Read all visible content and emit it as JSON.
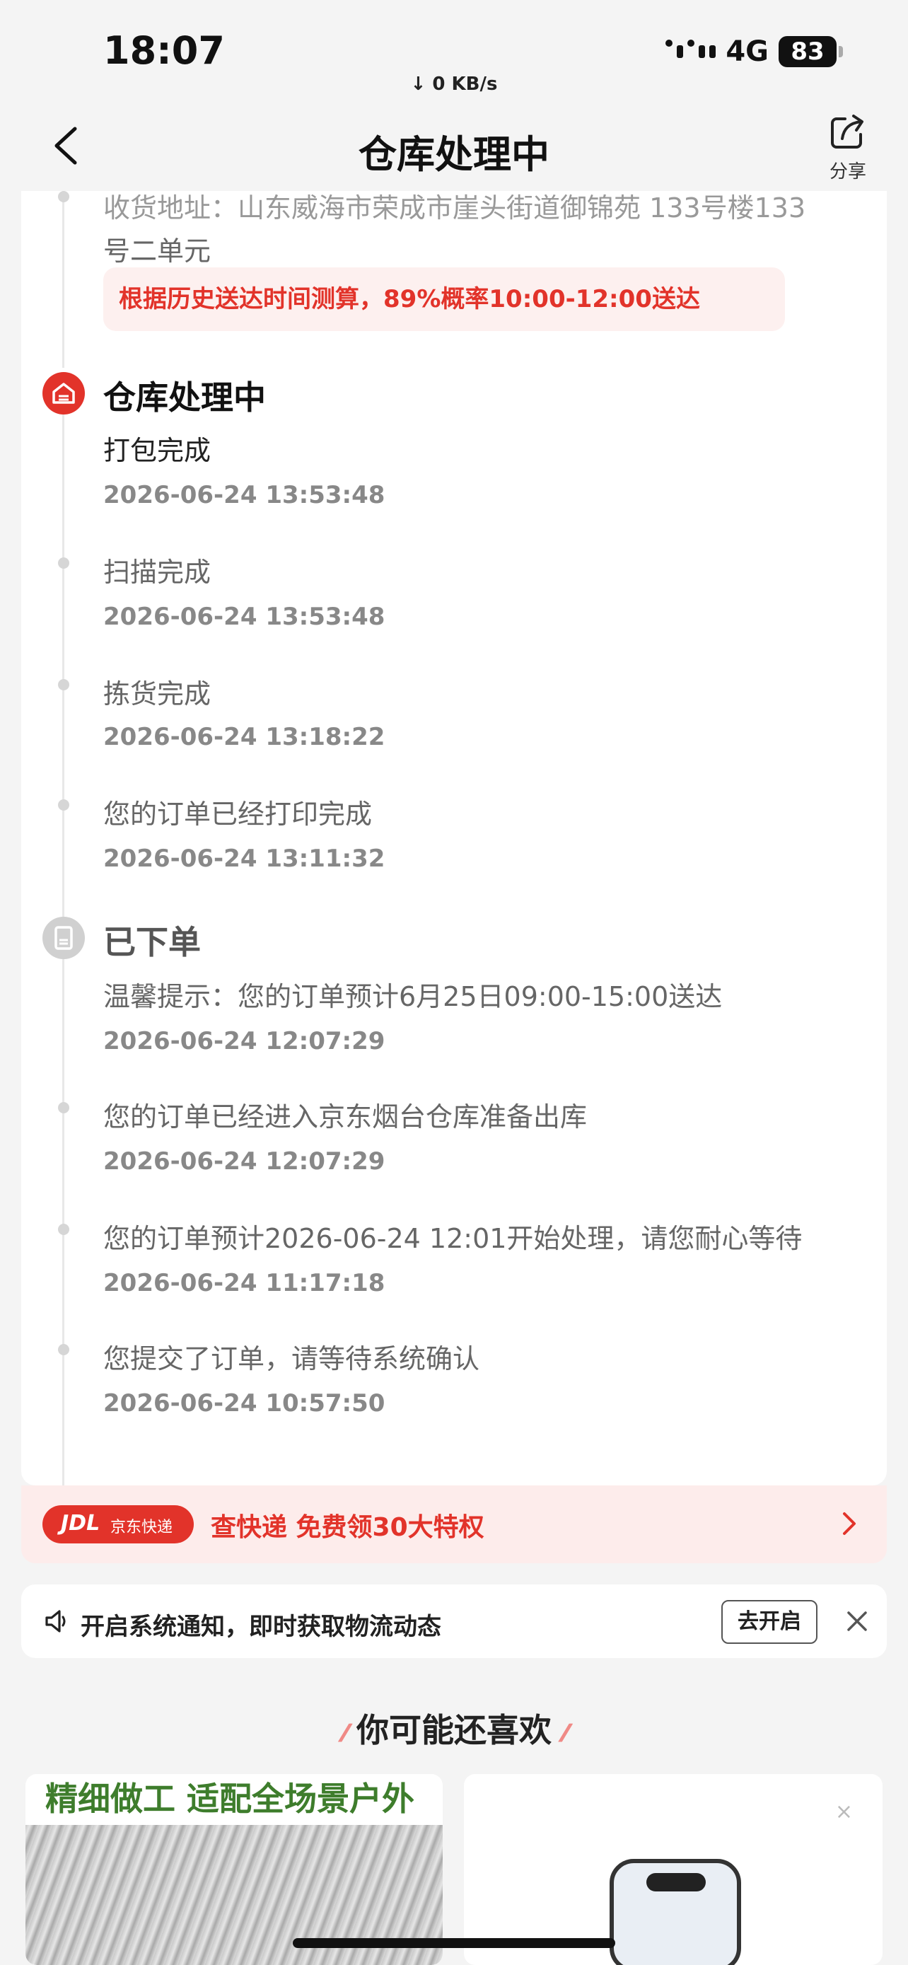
{
  "status_bar": {
    "time": "18:07",
    "speed": "↓ 0 KB/s",
    "network": "4G",
    "battery": "83"
  },
  "nav": {
    "title": "仓库处理中",
    "share_label": "分享"
  },
  "address": {
    "line1_partial": "收货地址：山东威海市荣成市崖头街道御锦苑 133号楼133",
    "line2": "号二单元"
  },
  "delivery_tip": "根据历史送达时间测算，89%概率10:00-12:00送达",
  "stages": [
    {
      "title": "仓库处理中",
      "events": [
        {
          "text": "打包完成",
          "time": "2026-06-24 13:53:48"
        },
        {
          "text": "扫描完成",
          "time": "2026-06-24 13:53:48"
        },
        {
          "text": "拣货完成",
          "time": "2026-06-24 13:18:22"
        },
        {
          "text": "您的订单已经打印完成",
          "time": "2026-06-24 13:11:32"
        }
      ]
    },
    {
      "title": "已下单",
      "events": [
        {
          "text": "温馨提示：您的订单预计6月25日09:00-15:00送达",
          "time": "2026-06-24 12:07:29"
        },
        {
          "text": "您的订单已经进入京东烟台仓库准备出库",
          "time": "2026-06-24 12:07:29"
        },
        {
          "text": "您的订单预计2026-06-24 12:01开始处理，请您耐心等待",
          "time": "2026-06-24 11:17:18"
        },
        {
          "text": "您提交了订单，请等待系统确认",
          "time": "2026-06-24 10:57:50"
        }
      ]
    }
  ],
  "promo": {
    "logo": "JDL",
    "brand": "京东快递",
    "text": "查快递 免费领30大特权"
  },
  "notification": {
    "text": "开启系统通知，即时获取物流动态",
    "button": "去开启"
  },
  "recommend": {
    "title": "你可能还喜欢",
    "product1_banner": "精细做工 适配全场景户外",
    "product2_close": "×"
  },
  "colors": {
    "accent": "#e2332a",
    "tip_bg": "#fdf0ef",
    "timeline_gray": "#d6d6d6"
  },
  "icons": {
    "back": "chevron-left-icon",
    "share": "share-icon",
    "warehouse": "warehouse-icon",
    "order": "document-icon",
    "speaker": "speaker-icon",
    "close": "close-icon",
    "arrow": "chevron-right-icon"
  }
}
